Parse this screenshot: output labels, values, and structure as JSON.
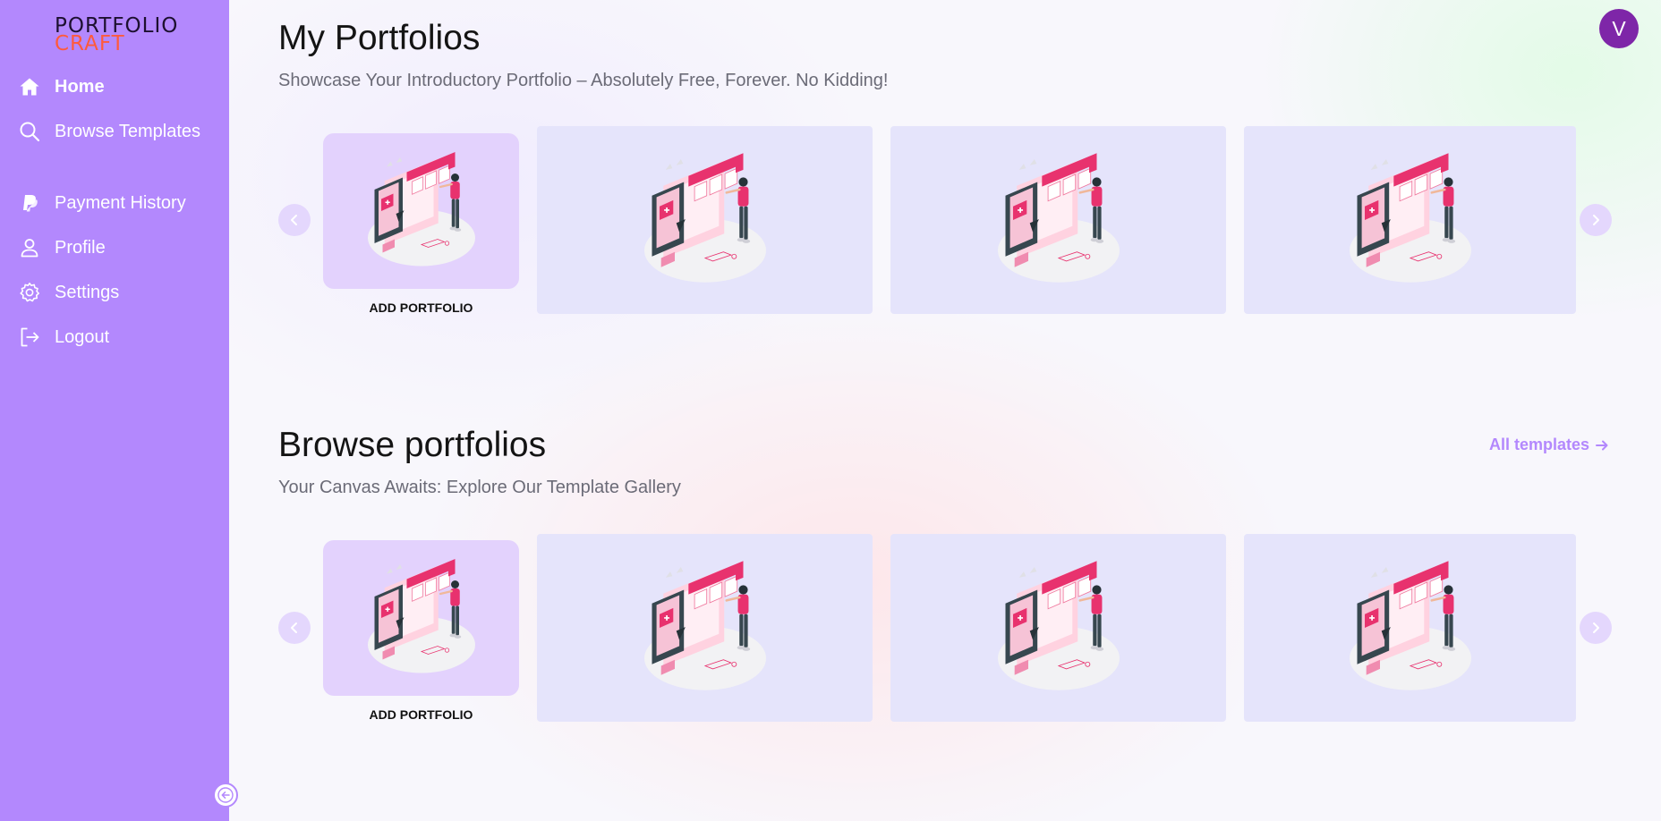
{
  "brand": {
    "line1": "PORTFOLIO",
    "line2": "CRAFT"
  },
  "sidebar": {
    "items": [
      {
        "label": "Home",
        "icon": "home-icon",
        "active": true
      },
      {
        "label": "Browse Templates",
        "icon": "search-icon"
      },
      {
        "label": "Payment History",
        "icon": "paypal-icon"
      },
      {
        "label": "Profile",
        "icon": "user-icon"
      },
      {
        "label": "Settings",
        "icon": "gear-icon"
      },
      {
        "label": "Logout",
        "icon": "logout-icon"
      }
    ],
    "collapse_icon": "arrow-left-circle-icon"
  },
  "user": {
    "initial": "V",
    "color": "#7e26a8"
  },
  "my_portfolios": {
    "title": "My Portfolios",
    "subtitle": "Showcase Your Introductory Portfolio – Absolutely Free, Forever. No Kidding!",
    "add_label": "ADD PORTFOLIO",
    "card_count": 3
  },
  "browse": {
    "title": "Browse portfolios",
    "subtitle": "Your Canvas Awaits: Explore Our Template Gallery",
    "all_link": "All templates",
    "add_label": "ADD PORTFOLIO",
    "card_count": 3
  },
  "colors": {
    "sidebar": "#b388fd",
    "accent": "#b388fd",
    "card_bg": "#e5e4fb",
    "add_card_bg": "#e3d2fd",
    "logo_craft": "#ff5a3c"
  }
}
